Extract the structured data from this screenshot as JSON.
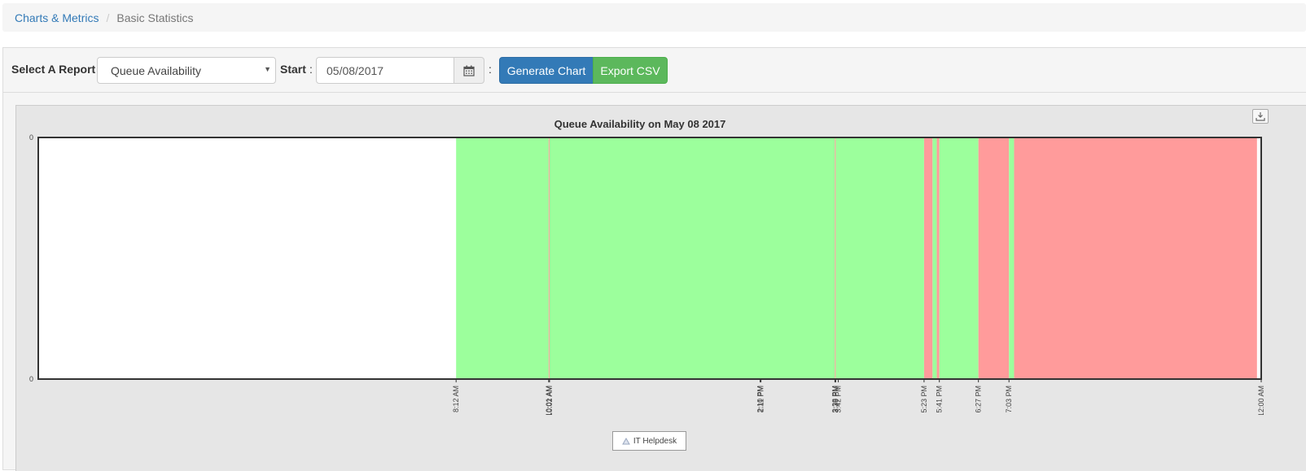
{
  "breadcrumb": {
    "link": "Charts & Metrics",
    "separator": "/",
    "current": "Basic Statistics"
  },
  "toolbar": {
    "report_label": "Select A Report",
    "report_selected": "Queue Availability",
    "start_label": "Start",
    "colon": ":",
    "start_value": "05/08/2017",
    "generate_label": "Generate Chart",
    "export_label": "Export CSV"
  },
  "colors": {
    "available": "#9cff9c",
    "unavailable": "#ff9b9b",
    "primary": "#337ab7",
    "success": "#5cb85c"
  },
  "icons": {
    "calendar": "calendar-icon",
    "export": "download-icon",
    "legend": "triangle-icon"
  },
  "chart_data": {
    "type": "area",
    "title": "Queue Availability on May 08 2017",
    "ylim": [
      0,
      0
    ],
    "y_ticks": [
      "0",
      "0"
    ],
    "x_range": [
      "12:00 AM",
      "12:00 AM"
    ],
    "x_tick_labels": [
      "8:12 AM",
      "10:01 AM",
      "10:02 AM",
      "2:10 PM",
      "2:11 PM",
      "3:38 PM",
      "3:39 PM",
      "3:42 PM",
      "5:23 PM",
      "5:41 PM",
      "6:27 PM",
      "7:03 PM",
      "12:00 AM"
    ],
    "legend": [
      "IT Helpdesk"
    ],
    "series": [
      {
        "name": "IT Helpdesk",
        "segments": [
          {
            "start": "8:12 AM",
            "end": "10:01 AM",
            "state": "available"
          },
          {
            "start": "10:01 AM",
            "end": "10:02 AM",
            "state": "unavailable"
          },
          {
            "start": "10:02 AM",
            "end": "3:38 PM",
            "state": "available"
          },
          {
            "start": "3:38 PM",
            "end": "3:39 PM",
            "state": "unavailable"
          },
          {
            "start": "3:39 PM",
            "end": "5:23 PM",
            "state": "available"
          },
          {
            "start": "5:23 PM",
            "end": "5:33 PM",
            "state": "unavailable"
          },
          {
            "start": "5:33 PM",
            "end": "5:38 PM",
            "state": "available"
          },
          {
            "start": "5:38 PM",
            "end": "5:41 PM",
            "state": "unavailable"
          },
          {
            "start": "5:41 PM",
            "end": "6:27 PM",
            "state": "available"
          },
          {
            "start": "6:27 PM",
            "end": "7:03 PM",
            "state": "unavailable"
          },
          {
            "start": "7:03 PM",
            "end": "7:09 PM",
            "state": "available"
          },
          {
            "start": "7:09 PM",
            "end": "11:55 PM",
            "state": "unavailable"
          }
        ]
      }
    ]
  }
}
